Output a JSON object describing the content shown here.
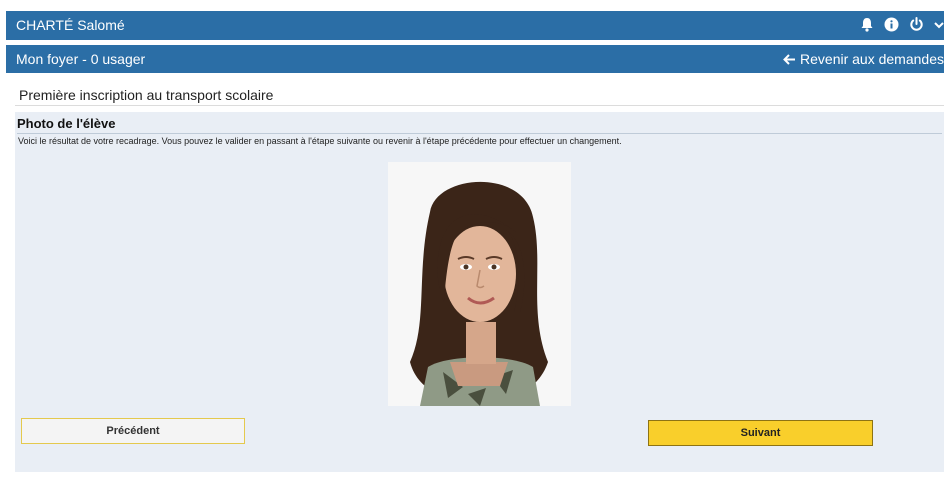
{
  "header": {
    "user_name": "CHARTÉ Salomé",
    "icons": [
      "bell-icon",
      "info-icon",
      "power-icon",
      "chevron-down-icon"
    ]
  },
  "subheader": {
    "household": "Mon foyer - 0 usager",
    "back_label": "Revenir aux demandes",
    "back_icon": "arrow-left-icon"
  },
  "page": {
    "title": "Première inscription au transport scolaire",
    "panel_title": "Photo de l'élève",
    "description": "Voici le résultat de votre recadrage. Vous pouvez le valider en passant à l'étape suivante ou revenir à l'étape précédente pour effectuer un changement."
  },
  "buttons": {
    "previous": "Précédent",
    "next": "Suivant"
  },
  "colors": {
    "header_bg": "#2b6ea6",
    "panel_bg": "#e9eef5",
    "next_button": "#f9cf2b"
  }
}
